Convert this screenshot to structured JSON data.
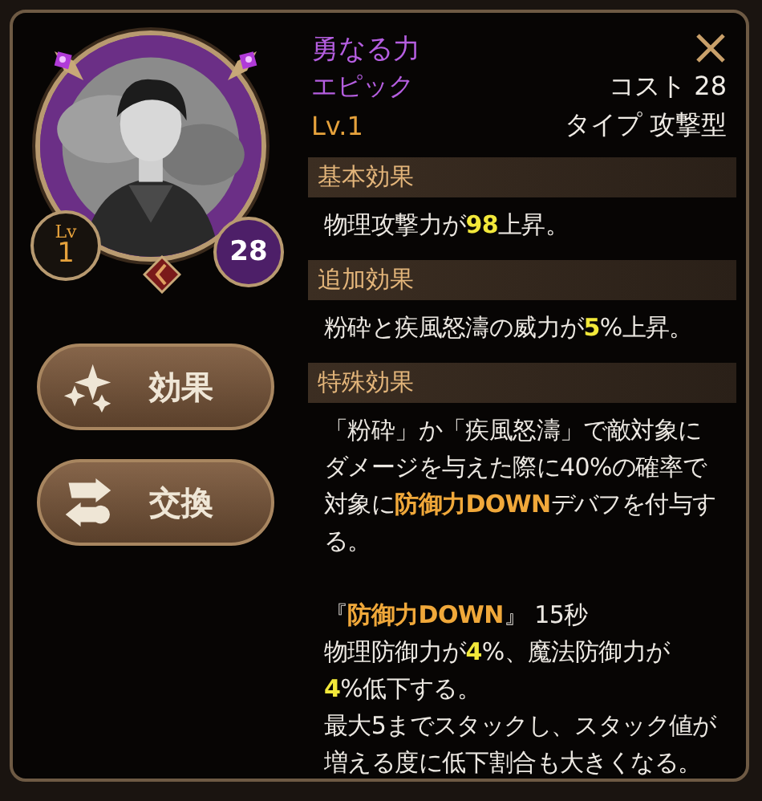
{
  "portrait": {
    "kind": "picture",
    "level_label": "Lv",
    "level_value": "1",
    "cost_value": "28"
  },
  "buttons": [
    {
      "label": "効果",
      "kind": "sparkle"
    },
    {
      "label": "交換",
      "kind": "swap"
    }
  ],
  "title": "勇なる力",
  "rarity": "エピック",
  "cost": "コスト 28",
  "level": "Lv.1",
  "type": "タイプ 攻撃型",
  "sections": [
    {
      "heading": "基本効果",
      "blocks": [
        [
          [
            {
              "text": "物理攻撃力が"
            },
            {
              "text": "98",
              "color": "#f2e83a"
            },
            {
              "text": "上昇。"
            }
          ]
        ]
      ]
    },
    {
      "heading": "追加効果",
      "blocks": [
        [
          [
            {
              "text": "粉砕と疾風怒濤の威力が"
            },
            {
              "text": "5",
              "color": "#f2e83a"
            },
            {
              "text": "%上昇。"
            }
          ]
        ]
      ]
    },
    {
      "heading": "特殊効果",
      "blocks": [
        [
          [
            {
              "text": "「粉砕」か「疾風怒濤」で敵対象に"
            }
          ],
          [
            {
              "text": "ダメージを与えた際に40%の確率で"
            }
          ],
          [
            {
              "text": "対象に"
            },
            {
              "text": "防御力DOWN",
              "color": "#f0a83a"
            },
            {
              "text": "デバフを付与す"
            }
          ],
          [
            {
              "text": "る。"
            }
          ]
        ],
        [
          [
            {
              "text": "『"
            },
            {
              "text": "防御力DOWN",
              "color": "#f0a83a"
            },
            {
              "text": "』 15秒"
            }
          ],
          [
            {
              "text": "物理防御力が"
            },
            {
              "text": "4",
              "color": "#f2e83a"
            },
            {
              "text": "%、魔法防御力が"
            }
          ],
          [
            {
              "text": "4",
              "color": "#f2e83a"
            },
            {
              "text": "%低下する。"
            }
          ],
          [
            {
              "text": "最大5までスタックし、スタック値が"
            }
          ],
          [
            {
              "text": "増える度に低下割合も大きくなる。"
            }
          ]
        ]
      ]
    }
  ]
}
